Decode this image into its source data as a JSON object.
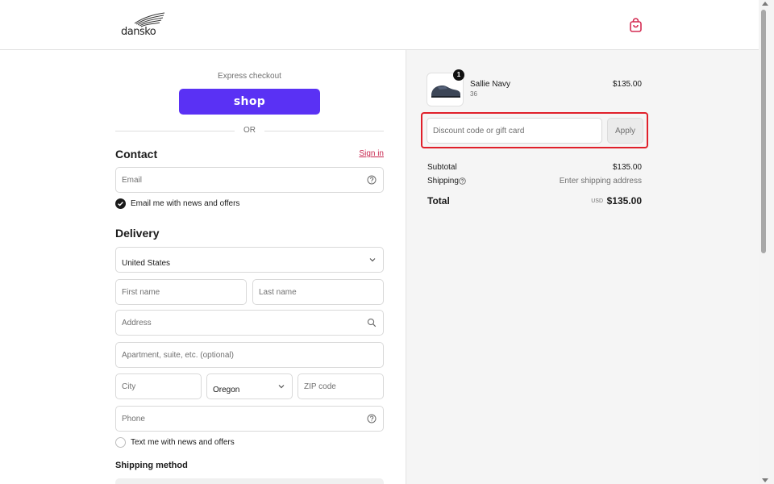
{
  "brand": {
    "logo_text": "dansko"
  },
  "express": {
    "label": "Express checkout",
    "shop_label": "shop",
    "or_label": "OR"
  },
  "contact": {
    "title": "Contact",
    "sign_in": "Sign in",
    "email_placeholder": "Email",
    "email_news_label": "Email me with news and offers",
    "email_news_checked": true
  },
  "delivery": {
    "title": "Delivery",
    "country_value": "United States",
    "first_name_placeholder": "First name",
    "last_name_placeholder": "Last name",
    "address_placeholder": "Address",
    "apartment_placeholder": "Apartment, suite, etc. (optional)",
    "city_placeholder": "City",
    "state_value": "Oregon",
    "zip_placeholder": "ZIP code",
    "phone_placeholder": "Phone",
    "text_news_label": "Text me with news and offers",
    "text_news_checked": false
  },
  "shipping_method": {
    "title": "Shipping method"
  },
  "summary": {
    "product": {
      "name": "Sallie Navy",
      "variant": "36",
      "price": "$135.00",
      "quantity": "1"
    },
    "discount_placeholder": "Discount code or gift card",
    "apply_label": "Apply",
    "subtotal_label": "Subtotal",
    "subtotal_value": "$135.00",
    "shipping_label": "Shipping",
    "shipping_value": "Enter shipping address",
    "total_label": "Total",
    "total_currency": "USD",
    "total_value": "$135.00"
  },
  "colors": {
    "shop_purple": "#5a31f4",
    "link_red": "#c7254e",
    "highlight_red": "#e0202a",
    "cart_icon": "#d42b52"
  }
}
